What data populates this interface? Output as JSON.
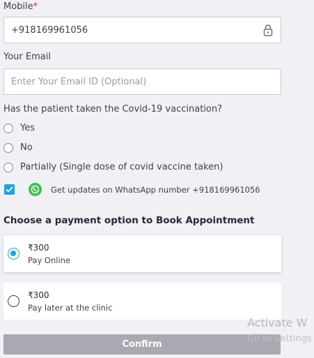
{
  "mobile": {
    "label": "Mobile",
    "required_mark": "*",
    "value": "+918169961056",
    "icon": "lock-icon"
  },
  "email": {
    "label": "Your Email",
    "placeholder": "Enter Your Email ID (Optional)",
    "value": ""
  },
  "vaccination": {
    "question": "Has the patient taken the Covid-19 vaccination?",
    "options": [
      {
        "label": "Yes",
        "selected": false
      },
      {
        "label": "No",
        "selected": false
      },
      {
        "label": "Partially (Single dose of covid vaccine taken)",
        "selected": false
      }
    ]
  },
  "whatsapp": {
    "checked": true,
    "icon": "whatsapp-icon",
    "label": "Get updates on WhatsApp number +918169961056"
  },
  "payment": {
    "title": "Choose a payment option to Book Appointment",
    "options": [
      {
        "amount": "₹300",
        "description": "Pay Online",
        "selected": true
      },
      {
        "amount": "₹300",
        "description": "Pay later at the clinic",
        "selected": false
      }
    ]
  },
  "confirm_label": "Confirm",
  "watermark": {
    "line1": "Activate W",
    "line2": "Go to Settings"
  },
  "colors": {
    "accent": "#1aa5e0",
    "whatsapp": "#3fc051",
    "required": "#e0252f",
    "disabled_button": "#a9a9b1"
  }
}
